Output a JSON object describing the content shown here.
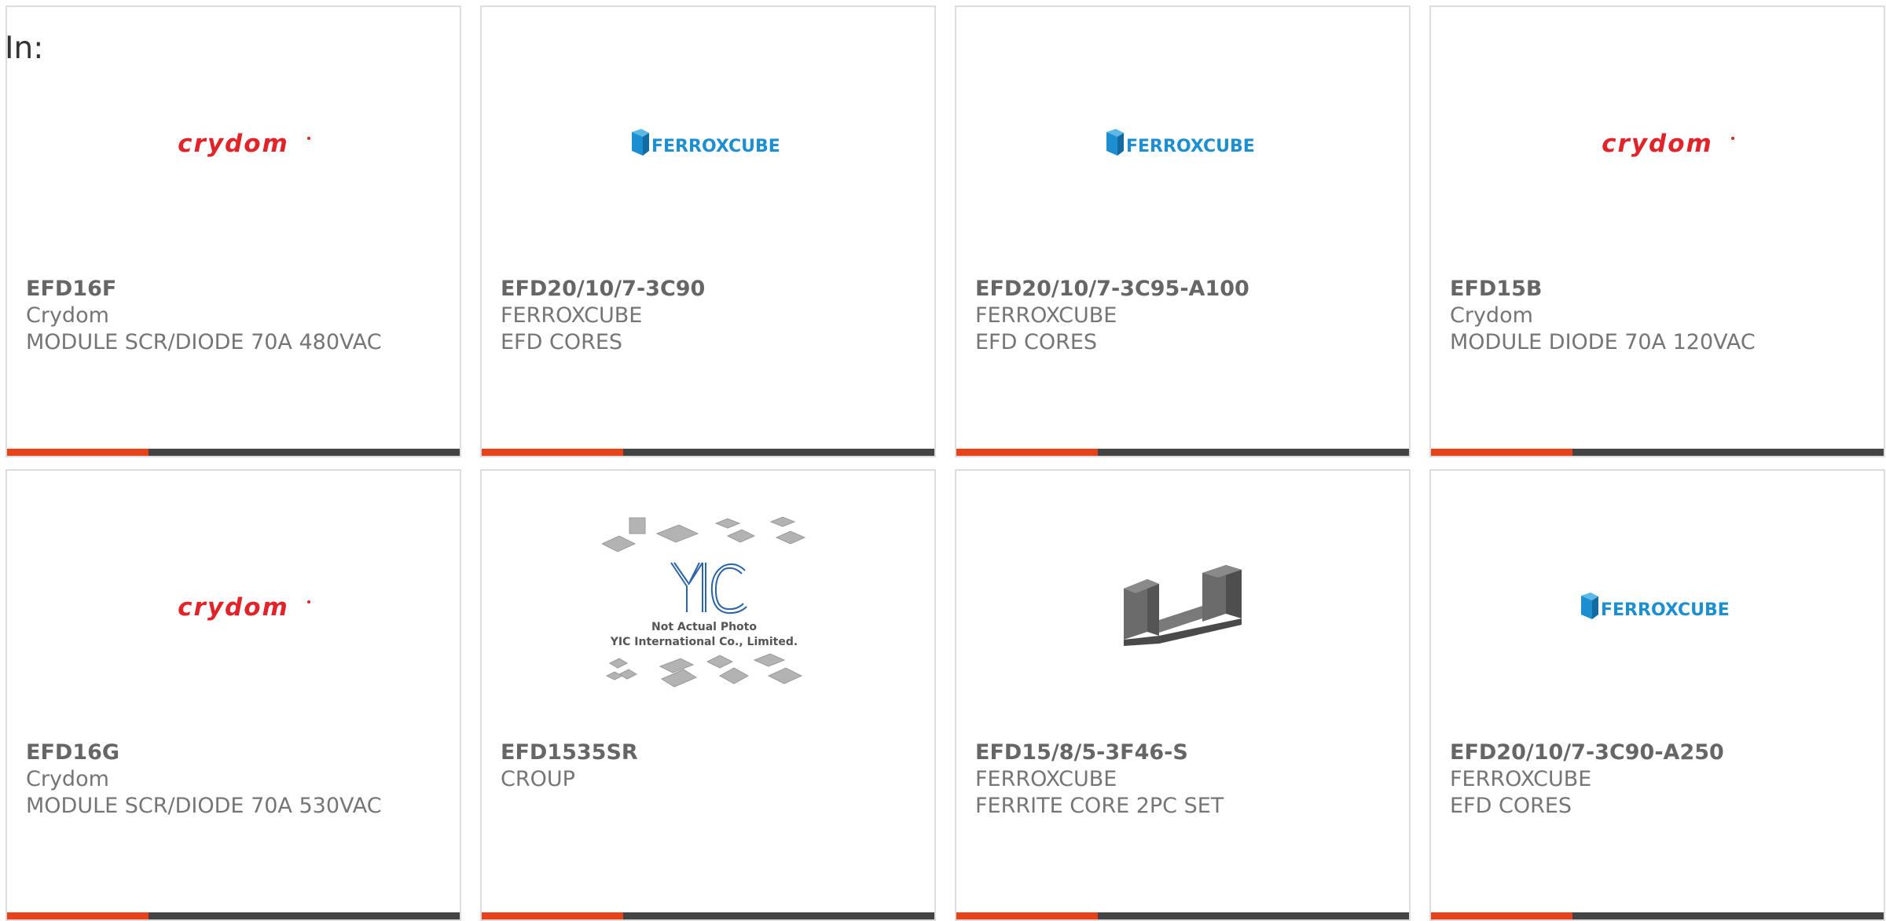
{
  "page": {
    "label": "In:"
  },
  "colors": {
    "accent": "#e8421b",
    "bar": "#444444",
    "crydom": "#e0242a",
    "ferroxcube": "#1d8fd0"
  },
  "products": [
    {
      "part_number": "EFD16F",
      "manufacturer": "Crydom",
      "description": "MODULE SCR/DIODE 70A 480VAC",
      "image": "crydom-logo"
    },
    {
      "part_number": "EFD20/10/7-3C90",
      "manufacturer": "FERROXCUBE",
      "description": "EFD CORES",
      "image": "ferroxcube-logo"
    },
    {
      "part_number": "EFD20/10/7-3C95-A100",
      "manufacturer": "FERROXCUBE",
      "description": "EFD CORES",
      "image": "ferroxcube-logo"
    },
    {
      "part_number": "EFD15B",
      "manufacturer": "Crydom",
      "description": "MODULE DIODE 70A 120VAC",
      "image": "crydom-logo"
    },
    {
      "part_number": "EFD16G",
      "manufacturer": "Crydom",
      "description": "MODULE SCR/DIODE 70A 530VAC",
      "image": "crydom-logo"
    },
    {
      "part_number": "EFD1535SR",
      "manufacturer": "CROUP",
      "description": "",
      "image": "not-actual-photo",
      "placeholder_line1": "Not Actual Photo",
      "placeholder_line2": "YIC International Co., Limited."
    },
    {
      "part_number": "EFD15/8/5-3F46-S",
      "manufacturer": "FERROXCUBE",
      "description": "FERRITE CORE 2PC SET",
      "image": "ferrite-core-photo"
    },
    {
      "part_number": "EFD20/10/7-3C90-A250",
      "manufacturer": "FERROXCUBE",
      "description": "EFD CORES",
      "image": "ferroxcube-logo"
    }
  ]
}
